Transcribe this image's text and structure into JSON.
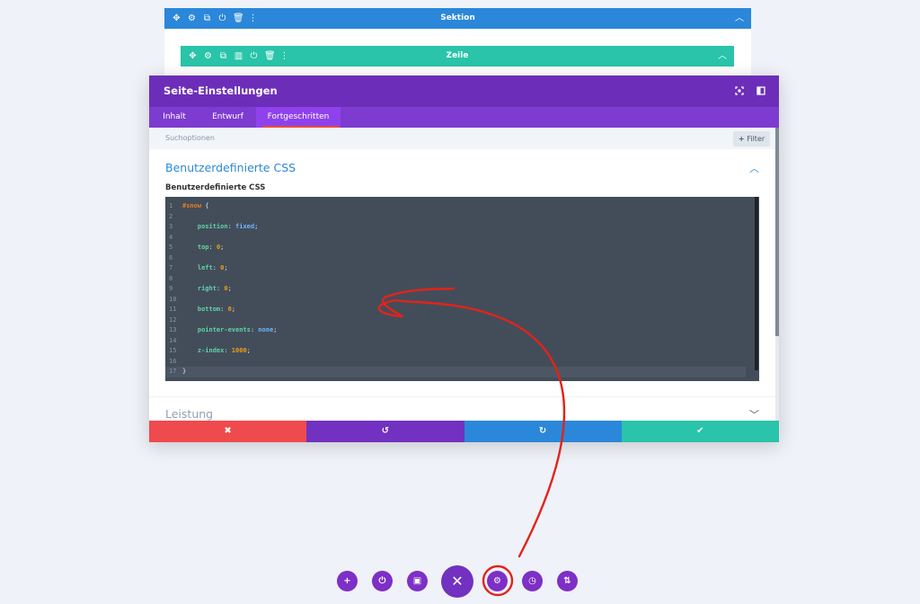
{
  "section_bar": {
    "title": "Sektion",
    "icons": [
      "move-icon",
      "gear-icon",
      "duplicate-icon",
      "power-icon",
      "trash-icon",
      "more-icon"
    ],
    "color": "#2b87da"
  },
  "row_bar": {
    "title": "Zeile",
    "icons": [
      "move-icon",
      "gear-icon",
      "duplicate-icon",
      "columns-icon",
      "power-icon",
      "trash-icon",
      "more-icon"
    ],
    "color": "#29c4a9"
  },
  "modal": {
    "title": "Seite-Einstellungen",
    "header_color": "#6c2eb9",
    "tabs": [
      {
        "label": "Inhalt",
        "active": false
      },
      {
        "label": "Entwurf",
        "active": false
      },
      {
        "label": "Fortgeschritten",
        "active": true
      }
    ],
    "search_label": "Suchoptionen",
    "filter_label": "Filter",
    "css_section_title": "Benutzerdefinierte CSS",
    "css_field_label": "Benutzerdefinierte CSS",
    "code_lines": [
      {
        "n": "1",
        "parts": [
          {
            "t": "#",
            "c": "tok-sel"
          },
          {
            "t": "snow",
            "c": "tok-sel"
          },
          {
            "t": " {",
            "c": "tok-punc"
          }
        ]
      },
      {
        "n": "2",
        "parts": []
      },
      {
        "n": "3",
        "parts": [
          {
            "t": "    position",
            "c": "tok-prop"
          },
          {
            "t": ": ",
            "c": "tok-punc"
          },
          {
            "t": "fixed",
            "c": "tok-kw"
          },
          {
            "t": ";",
            "c": "tok-punc"
          }
        ]
      },
      {
        "n": "4",
        "parts": []
      },
      {
        "n": "5",
        "parts": [
          {
            "t": "    top",
            "c": "tok-prop"
          },
          {
            "t": ": ",
            "c": "tok-punc"
          },
          {
            "t": "0",
            "c": "tok-num"
          },
          {
            "t": ";",
            "c": "tok-punc"
          }
        ]
      },
      {
        "n": "6",
        "parts": []
      },
      {
        "n": "7",
        "parts": [
          {
            "t": "    left",
            "c": "tok-prop"
          },
          {
            "t": ": ",
            "c": "tok-punc"
          },
          {
            "t": "0",
            "c": "tok-num"
          },
          {
            "t": ";",
            "c": "tok-punc"
          }
        ]
      },
      {
        "n": "8",
        "parts": []
      },
      {
        "n": "9",
        "parts": [
          {
            "t": "    right",
            "c": "tok-prop"
          },
          {
            "t": ": ",
            "c": "tok-punc"
          },
          {
            "t": "0",
            "c": "tok-num"
          },
          {
            "t": ";",
            "c": "tok-punc"
          }
        ]
      },
      {
        "n": "10",
        "parts": []
      },
      {
        "n": "11",
        "parts": [
          {
            "t": "    bottom",
            "c": "tok-prop"
          },
          {
            "t": ": ",
            "c": "tok-punc"
          },
          {
            "t": "0",
            "c": "tok-num"
          },
          {
            "t": ";",
            "c": "tok-punc"
          }
        ]
      },
      {
        "n": "12",
        "parts": []
      },
      {
        "n": "13",
        "parts": [
          {
            "t": "    pointer-events",
            "c": "tok-prop"
          },
          {
            "t": ": ",
            "c": "tok-punc"
          },
          {
            "t": "none",
            "c": "tok-kw"
          },
          {
            "t": ";",
            "c": "tok-punc"
          }
        ]
      },
      {
        "n": "14",
        "parts": []
      },
      {
        "n": "15",
        "parts": [
          {
            "t": "    z-index",
            "c": "tok-prop"
          },
          {
            "t": ": ",
            "c": "tok-punc"
          },
          {
            "t": "1000",
            "c": "tok-num"
          },
          {
            "t": ";",
            "c": "tok-punc"
          }
        ]
      },
      {
        "n": "16",
        "parts": []
      },
      {
        "n": "17",
        "parts": [
          {
            "t": "}",
            "c": "tok-punc"
          }
        ]
      }
    ],
    "perf_section_title": "Leistung",
    "actions": [
      {
        "name": "discard-button",
        "icon": "close-icon",
        "glyph": "✖",
        "color": "#ef4a4d"
      },
      {
        "name": "undo-button",
        "icon": "undo-icon",
        "glyph": "↺",
        "color": "#7231c0"
      },
      {
        "name": "redo-button",
        "icon": "redo-icon",
        "glyph": "↻",
        "color": "#2b87da"
      },
      {
        "name": "save-button",
        "icon": "check-icon",
        "glyph": "✔",
        "color": "#29c4a9"
      }
    ]
  },
  "bottom_toolbar": {
    "buttons": [
      {
        "name": "add-button",
        "icon": "plus-icon",
        "glyph": "+"
      },
      {
        "name": "disable-button",
        "icon": "power-icon",
        "glyph": "⏻"
      },
      {
        "name": "delete-button",
        "icon": "trash-icon",
        "glyph": "🗑"
      },
      {
        "name": "close-builder-button",
        "icon": "close-icon",
        "glyph": "✕"
      },
      {
        "name": "page-settings-button",
        "icon": "gear-icon",
        "glyph": "⚙"
      },
      {
        "name": "history-button",
        "icon": "clock-icon",
        "glyph": "◷"
      },
      {
        "name": "portability-button",
        "icon": "sort-arrows-icon",
        "glyph": "⇅"
      }
    ],
    "accent": "#7d2fc6"
  },
  "annotation_color": "#e2231a"
}
